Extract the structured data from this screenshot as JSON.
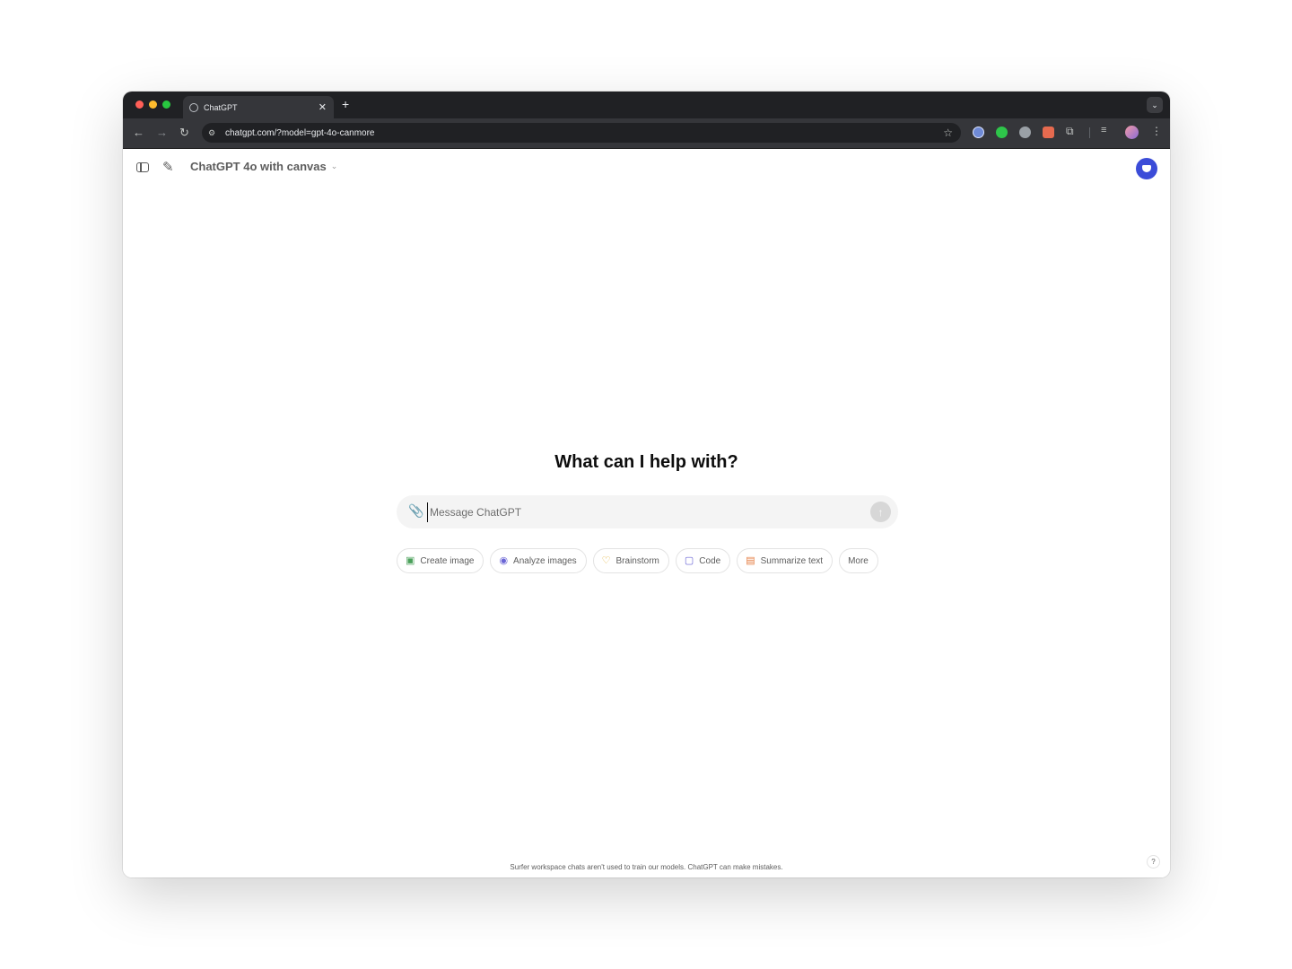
{
  "browser": {
    "tab_title": "ChatGPT",
    "url": "chatgpt.com/?model=gpt-4o-canmore",
    "new_tab_symbol": "+",
    "icons": {
      "back": "arrow-left-icon",
      "forward": "arrow-right-icon",
      "reload": "reload-icon",
      "bookmark": "star-icon",
      "extensions": "puzzle-icon",
      "menu": "kebab-icon"
    }
  },
  "header": {
    "model_name": "ChatGPT 4o with canvas",
    "icons": {
      "sidebar": "sidebar-toggle-icon",
      "new_chat": "new-chat-icon",
      "workspace": "workspace-badge-icon"
    },
    "accent_color": "#3b4cd8"
  },
  "main": {
    "headline": "What can I help with?",
    "composer": {
      "placeholder": "Message ChatGPT",
      "value": ""
    },
    "suggestions": [
      {
        "label": "Create image",
        "icon": "image-icon",
        "color": "#4aa05a"
      },
      {
        "label": "Analyze images",
        "icon": "eye-icon",
        "color": "#6b66d6"
      },
      {
        "label": "Brainstorm",
        "icon": "lightbulb-icon",
        "color": "#e2b134"
      },
      {
        "label": "Code",
        "icon": "code-icon",
        "color": "#6b66d6"
      },
      {
        "label": "Summarize text",
        "icon": "document-icon",
        "color": "#e57a3e"
      },
      {
        "label": "More",
        "icon": "",
        "color": ""
      }
    ]
  },
  "footer": {
    "note": "Surfer workspace chats aren't used to train our models. ChatGPT can make mistakes.",
    "help_label": "?"
  }
}
